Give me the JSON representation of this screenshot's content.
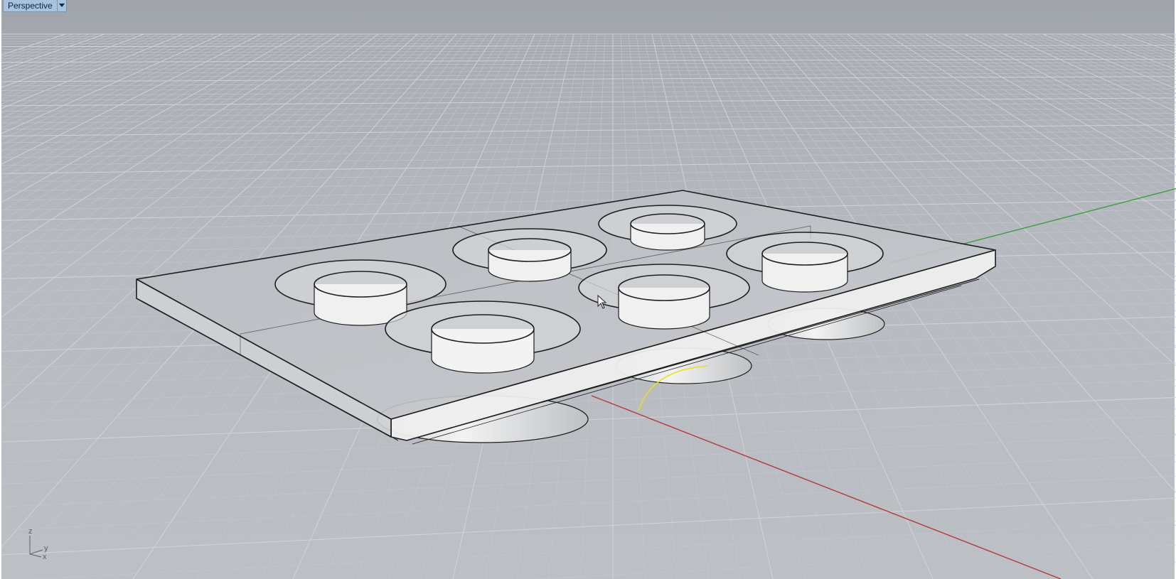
{
  "viewport": {
    "title": "Perspective",
    "menu_icon": "chevron-down-icon",
    "background": "#b4b8be",
    "grid_minor_color": "#c4c7cc",
    "grid_major_color": "#d0d3d7"
  },
  "axes": {
    "x_color": "#b23a3a",
    "y_color": "#3a9b3a",
    "widget": {
      "z": "z",
      "y": "y",
      "x": "x"
    }
  },
  "model": {
    "name": "tray-with-six-cylindrical-cups",
    "cup_count": 6,
    "edge_color": "#1e1e1e",
    "surface_color": "#d8d9db"
  },
  "selection_arc_color": "#e6e020"
}
